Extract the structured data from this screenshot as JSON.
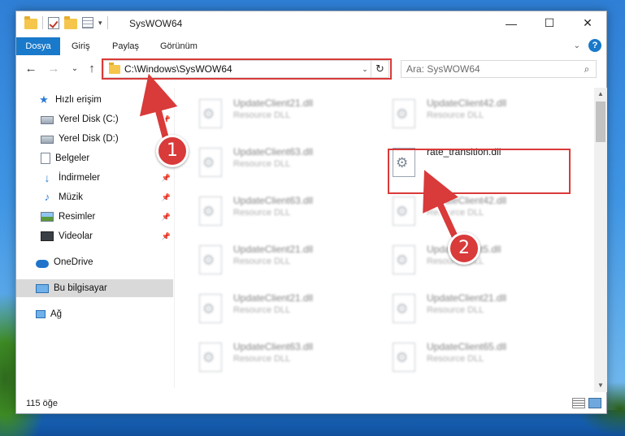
{
  "window": {
    "title": "SysWOW64",
    "controls": {
      "minimize": "—",
      "maximize": "☐",
      "close": "✕"
    }
  },
  "quick_access_toolbar": {
    "icons": [
      "folder-icon",
      "properties-check-icon",
      "new-folder-icon",
      "customize-icon"
    ],
    "dropdown": "▾"
  },
  "ribbon": {
    "tabs": [
      {
        "label": "Dosya",
        "active": true
      },
      {
        "label": "Giriş",
        "active": false
      },
      {
        "label": "Paylaş",
        "active": false
      },
      {
        "label": "Görünüm",
        "active": false
      }
    ],
    "expand_glyph": "⌄",
    "help_glyph": "?"
  },
  "navigation": {
    "back": "←",
    "forward": "→",
    "recent": "⌄",
    "up": "↑"
  },
  "address_bar": {
    "path": "C:\\Windows\\SysWOW64",
    "dropdown_glyph": "⌄",
    "refresh_glyph": "↻"
  },
  "search": {
    "placeholder": "Ara: SysWOW64",
    "icon": "search-icon"
  },
  "nav_pane": {
    "items": [
      {
        "label": "Hızlı erişim",
        "icon": "star-icon",
        "pinned": false,
        "selected": false
      },
      {
        "label": "Yerel Disk (C:)",
        "icon": "disk-icon",
        "pinned": true,
        "selected": false
      },
      {
        "label": "Yerel Disk (D:)",
        "icon": "disk-icon",
        "pinned": false,
        "selected": false
      },
      {
        "label": "Belgeler",
        "icon": "documents-icon",
        "pinned": true,
        "selected": false
      },
      {
        "label": "İndirmeler",
        "icon": "download-icon",
        "pinned": true,
        "selected": false
      },
      {
        "label": "Müzik",
        "icon": "music-icon",
        "pinned": true,
        "selected": false
      },
      {
        "label": "Resimler",
        "icon": "pictures-icon",
        "pinned": true,
        "selected": false
      },
      {
        "label": "Videolar",
        "icon": "videos-icon",
        "pinned": true,
        "selected": false
      },
      {
        "label": "OneDrive",
        "icon": "cloud-icon",
        "pinned": false,
        "selected": false
      },
      {
        "label": "Bu bilgisayar",
        "icon": "computer-icon",
        "pinned": false,
        "selected": true
      },
      {
        "label": "Ağ",
        "icon": "network-icon",
        "pinned": false,
        "selected": false
      }
    ],
    "pin_glyph": "📌"
  },
  "files": [
    {
      "name": "UpdateClient21.dll",
      "type": "Resource DLL",
      "blurred": true
    },
    {
      "name": "UpdateClient42.dll",
      "type": "Resource DLL",
      "blurred": true
    },
    {
      "name": "UpdateClient63.dll",
      "type": "Resource DLL",
      "blurred": true
    },
    {
      "name": "rate_transition.dll",
      "type": "",
      "blurred": false,
      "highlighted": true
    },
    {
      "name": "UpdateClient63.dll",
      "type": "Resource DLL",
      "blurred": true
    },
    {
      "name": "UpdateClient42.dll",
      "type": "Resource DLL",
      "blurred": true
    },
    {
      "name": "UpdateClient21.dll",
      "type": "Resource DLL",
      "blurred": true
    },
    {
      "name": "UpdateClient5.dll",
      "type": "Resource DLL",
      "blurred": true
    },
    {
      "name": "UpdateClient21.dll",
      "type": "Resource DLL",
      "blurred": true
    },
    {
      "name": "UpdateClient21.dll",
      "type": "Resource DLL",
      "blurred": true
    },
    {
      "name": "UpdateClient63.dll",
      "type": "Resource DLL",
      "blurred": true
    },
    {
      "name": "UpdateClient65.dll",
      "type": "Resource DLL",
      "blurred": true
    }
  ],
  "scrollbar": {
    "up": "▲",
    "down": "▼"
  },
  "status": {
    "item_count": "115 öğe"
  },
  "annotations": {
    "step1": "1",
    "step2": "2",
    "color": "#d93a3a"
  }
}
